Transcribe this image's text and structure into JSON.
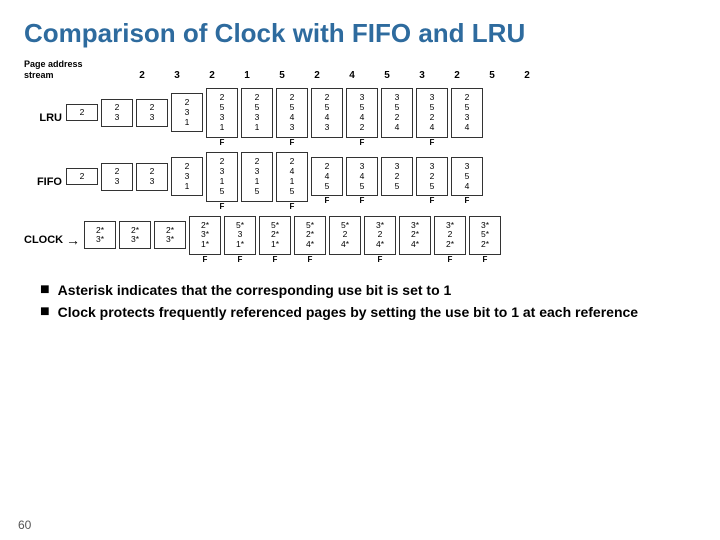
{
  "title": "Comparison of Clock with FIFO and LRU",
  "stream": {
    "label": "Page address\nstream",
    "values": [
      "2",
      "3",
      "2",
      "1",
      "5",
      "2",
      "4",
      "5",
      "3",
      "2",
      "5",
      "2"
    ]
  },
  "lru": {
    "label": "LRU",
    "columns": [
      {
        "cells": [
          "2",
          "",
          "",
          ""
        ],
        "f": ""
      },
      {
        "cells": [
          "2",
          "3",
          "",
          ""
        ],
        "f": ""
      },
      {
        "cells": [
          "2",
          "3",
          "",
          ""
        ],
        "f": ""
      },
      {
        "cells": [
          "2",
          "3",
          "1",
          ""
        ],
        "f": ""
      },
      {
        "cells": [
          "2",
          "5",
          "3",
          "1"
        ],
        "f": "F"
      },
      {
        "cells": [
          "2",
          "5",
          "3",
          "1"
        ],
        "f": ""
      },
      {
        "cells": [
          "2",
          "5",
          "4",
          "3"
        ],
        "f": "F"
      },
      {
        "cells": [
          "2",
          "5",
          "4",
          "3"
        ],
        "f": ""
      },
      {
        "cells": [
          "3",
          "5",
          "4",
          "2"
        ],
        "f": "F"
      },
      {
        "cells": [
          "3",
          "5",
          "2",
          "4"
        ],
        "f": ""
      },
      {
        "cells": [
          "3",
          "5",
          "2",
          "4"
        ],
        "f": "F"
      },
      {
        "cells": [
          "2",
          "5",
          "3",
          "4"
        ],
        "f": ""
      }
    ]
  },
  "fifo": {
    "label": "FIFO",
    "columns": [
      {
        "cells": [
          "2",
          "",
          "",
          ""
        ],
        "f": ""
      },
      {
        "cells": [
          "2",
          "3",
          "",
          ""
        ],
        "f": ""
      },
      {
        "cells": [
          "2",
          "3",
          "",
          ""
        ],
        "f": ""
      },
      {
        "cells": [
          "2",
          "3",
          "1",
          ""
        ],
        "f": ""
      },
      {
        "cells": [
          "2",
          "3",
          "1",
          "5"
        ],
        "f": "F"
      },
      {
        "cells": [
          "2",
          "3",
          "1",
          "5"
        ],
        "f": ""
      },
      {
        "cells": [
          "2",
          "4",
          "1",
          "5"
        ],
        "f": "F"
      },
      {
        "cells": [
          "2",
          "4",
          "5",
          ""
        ],
        "f": "F"
      },
      {
        "cells": [
          "3",
          "4",
          "5",
          ""
        ],
        "f": "F"
      },
      {
        "cells": [
          "3",
          "2",
          "5",
          ""
        ],
        "f": ""
      },
      {
        "cells": [
          "3",
          "2",
          "5",
          ""
        ],
        "f": "F"
      },
      {
        "cells": [
          "3",
          "5",
          "4",
          ""
        ],
        "f": "F"
      }
    ]
  },
  "clock": {
    "label": "CLOCK",
    "arrow": "→",
    "columns": [
      {
        "cells": [
          "2*",
          "3*",
          "",
          ""
        ],
        "f": ""
      },
      {
        "cells": [
          "2*",
          "3*",
          "",
          ""
        ],
        "f": ""
      },
      {
        "cells": [
          "2*",
          "3*",
          "",
          ""
        ],
        "f": ""
      },
      {
        "cells": [
          "2*",
          "3*",
          "1*",
          ""
        ],
        "f": "F"
      },
      {
        "cells": [
          "5*",
          "3",
          "1*",
          ""
        ],
        "f": "F"
      },
      {
        "cells": [
          "5*",
          "2*",
          "1*",
          ""
        ],
        "f": "F"
      },
      {
        "cells": [
          "5*",
          "2*",
          "4*",
          ""
        ],
        "f": "F"
      },
      {
        "cells": [
          "5*",
          "2",
          "4*",
          ""
        ],
        "f": ""
      },
      {
        "cells": [
          "3*",
          "2",
          "4*",
          ""
        ],
        "f": "F"
      },
      {
        "cells": [
          "3*",
          "2*",
          "4*",
          ""
        ],
        "f": ""
      },
      {
        "cells": [
          "3*",
          "2",
          "2*",
          ""
        ],
        "f": "F"
      },
      {
        "cells": [
          "3*",
          "5*",
          "2*",
          ""
        ],
        "f": "F"
      }
    ]
  },
  "bullets": [
    "Asterisk indicates that the corresponding use\nbit is set to 1",
    "Clock protects frequently referenced pages by\nsetting the use bit to 1 at each reference"
  ],
  "page_number": "60"
}
